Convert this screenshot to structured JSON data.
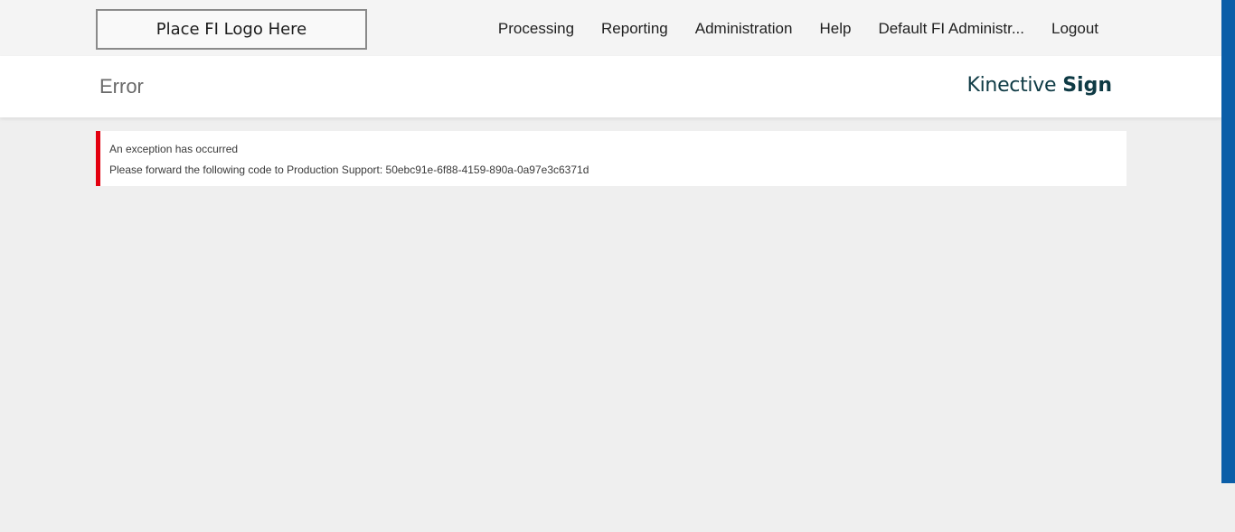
{
  "header": {
    "logo_text": "Place FI Logo Here",
    "nav": [
      {
        "label": "Processing"
      },
      {
        "label": "Reporting"
      },
      {
        "label": "Administration"
      },
      {
        "label": "Help"
      },
      {
        "label": "Default FI Administr..."
      },
      {
        "label": "Logout"
      }
    ]
  },
  "title_bar": {
    "page_title": "Error",
    "brand_light": "Kinective",
    "brand_bold": "Sign"
  },
  "alert": {
    "message": "An exception has occurred",
    "detail": "Please forward the following code to Production Support: 50ebc91e-6f88-4159-890a-0a97e3c6371d"
  },
  "colors": {
    "alert_accent": "#e3000f",
    "brand": "#0e3a44",
    "scrollbar": "#0b5ea8"
  }
}
